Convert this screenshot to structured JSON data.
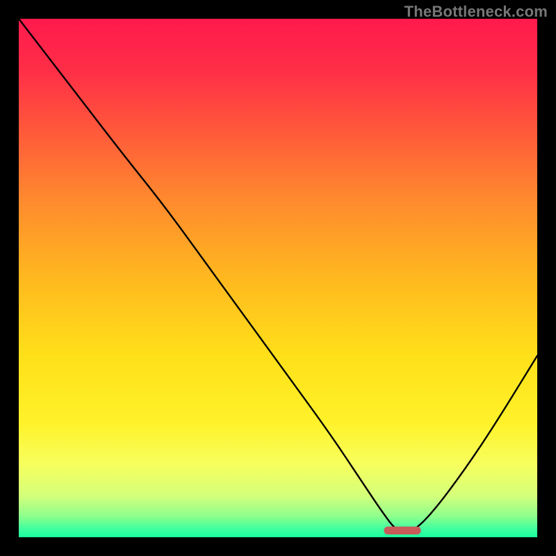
{
  "watermark": "TheBottleneck.com",
  "colors": {
    "frame": "#000000",
    "watermark": "#777777",
    "gradient_stops": [
      {
        "offset": 0.0,
        "color": "#ff1a4d"
      },
      {
        "offset": 0.1,
        "color": "#ff2e47"
      },
      {
        "offset": 0.22,
        "color": "#ff5a3a"
      },
      {
        "offset": 0.35,
        "color": "#ff8a2e"
      },
      {
        "offset": 0.5,
        "color": "#ffb81f"
      },
      {
        "offset": 0.65,
        "color": "#ffe019"
      },
      {
        "offset": 0.78,
        "color": "#fff22a"
      },
      {
        "offset": 0.86,
        "color": "#f6ff5e"
      },
      {
        "offset": 0.92,
        "color": "#d4ff7a"
      },
      {
        "offset": 0.96,
        "color": "#8dff8d"
      },
      {
        "offset": 0.985,
        "color": "#3bffa0"
      },
      {
        "offset": 1.0,
        "color": "#19ff9e"
      }
    ],
    "curve": "#000000",
    "marker_fill": "#c85a5a",
    "marker_stroke": "#c85a5a"
  },
  "chart_data": {
    "type": "line",
    "title": "",
    "xlabel": "",
    "ylabel": "",
    "xlim": [
      0,
      100
    ],
    "ylim": [
      0,
      100
    ],
    "annotations": [],
    "series": [
      {
        "name": "bottleneck-curve",
        "x": [
          0,
          10,
          20,
          28,
          36,
          44,
          52,
          60,
          66,
          70,
          73,
          76,
          80,
          86,
          92,
          100
        ],
        "y": [
          100,
          87,
          74,
          64,
          53,
          42,
          31,
          20,
          11,
          5,
          1,
          1,
          5,
          13,
          22,
          35
        ]
      }
    ],
    "marker": {
      "name": "optimal-range",
      "x_start": 70.5,
      "x_end": 77.5,
      "y": 0.6,
      "height": 1.4
    }
  }
}
